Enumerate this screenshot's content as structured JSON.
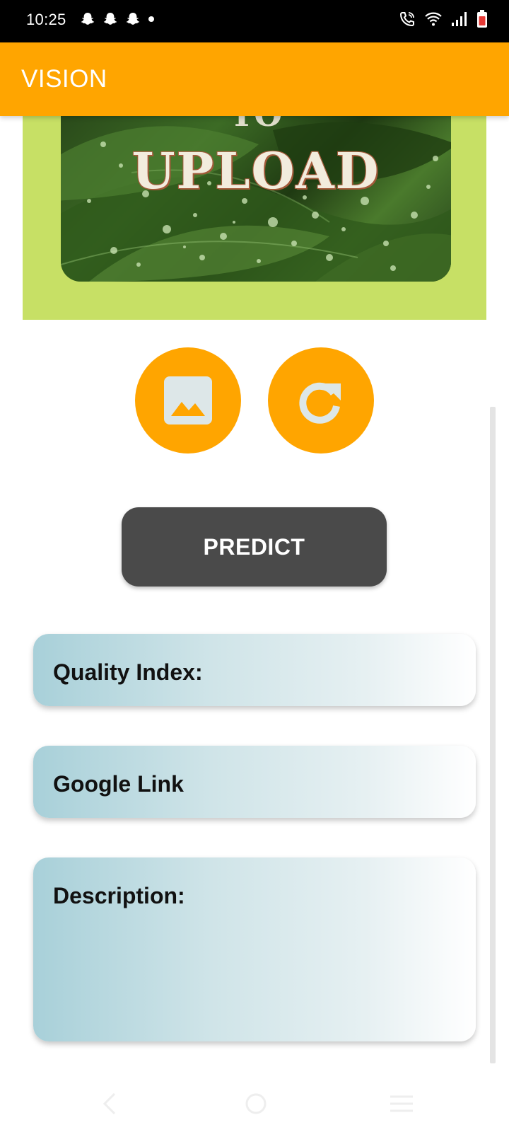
{
  "status_bar": {
    "time": "10:25",
    "notification_icons": [
      "snapchat-icon",
      "snapchat-icon",
      "snapchat-icon",
      "dot-icon"
    ],
    "system_icons": [
      "call-icon",
      "wifi-icon",
      "signal-icon",
      "battery-icon"
    ]
  },
  "app_bar": {
    "title": "VISION",
    "color": "#FFA500"
  },
  "upload_image": {
    "text": "UPLOAD",
    "background": "#C7E065"
  },
  "actions": {
    "gallery_icon": "image-icon",
    "refresh_icon": "refresh-icon"
  },
  "predict_button": {
    "label": "PREDICT"
  },
  "results": {
    "quality_label": "Quality Index:",
    "link_label": "Google Link",
    "description_label": "Description:"
  },
  "nav_bar": {
    "icons": [
      "back-icon",
      "home-icon",
      "recents-icon"
    ]
  }
}
